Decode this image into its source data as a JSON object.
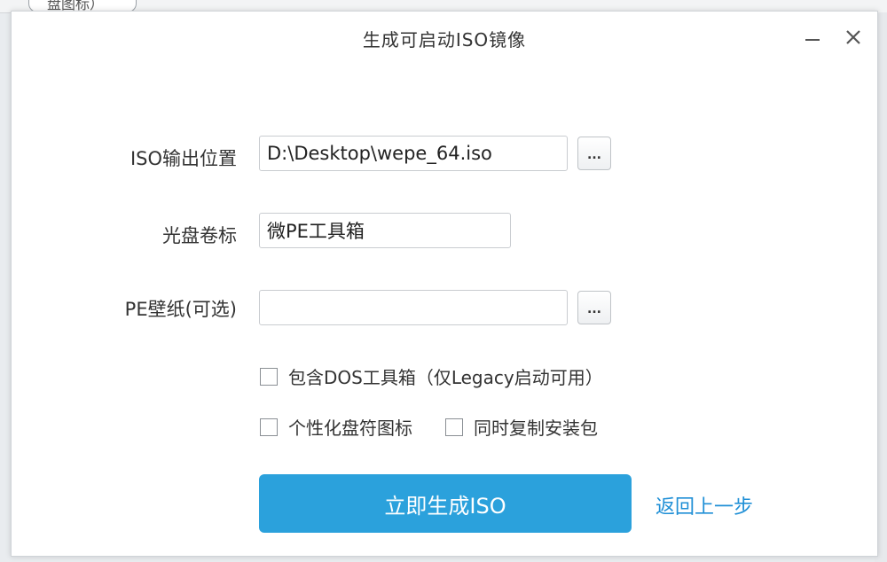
{
  "background": {
    "tab_text": "盘图标）"
  },
  "window": {
    "title": "生成可启动ISO镜像"
  },
  "form": {
    "iso_output": {
      "label": "ISO输出位置",
      "value": "D:\\Desktop\\wepe_64.iso",
      "browse_label": "..."
    },
    "disc_label": {
      "label": "光盘卷标",
      "value": "微PE工具箱"
    },
    "wallpaper": {
      "label": "PE壁纸(可选)",
      "value": "",
      "browse_label": "..."
    }
  },
  "options": {
    "dos_toolbox": {
      "label": "包含DOS工具箱（仅Legacy启动可用）",
      "checked": false
    },
    "custom_icon": {
      "label": "个性化盘符图标",
      "checked": false
    },
    "copy_installer": {
      "label": "同时复制安装包",
      "checked": false
    }
  },
  "actions": {
    "generate": "立即生成ISO",
    "back": "返回上一步"
  },
  "colors": {
    "accent": "#2ba1dc",
    "link": "#1f8fd6"
  }
}
